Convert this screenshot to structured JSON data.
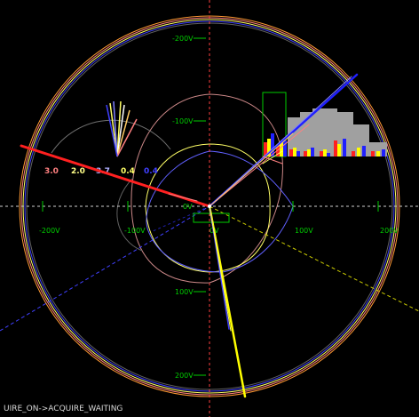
{
  "scale_labels": {
    "left_200": "-200V",
    "left_100": "-100V",
    "right_100": "100V",
    "right_200": "200V",
    "top_200": "-200V",
    "top_100": "-100V",
    "bottom_100": "100V",
    "bottom_200": "200V",
    "center_x": "0V",
    "center_y": "0V"
  },
  "fan_labels": {
    "l1": "3.0",
    "l2": "2.0",
    "l3": "3.7",
    "l4": "0.4",
    "l5": "0.4"
  },
  "status_text": "UIRE_ON->ACQUIRE_WAITING",
  "colors": {
    "axis_green": "#00cc00",
    "fan_red": "#ff8080",
    "fan_yellow": "#ffff66",
    "fan_blue": "#8080ff",
    "histogram_gray": "#a0a0a0"
  }
}
